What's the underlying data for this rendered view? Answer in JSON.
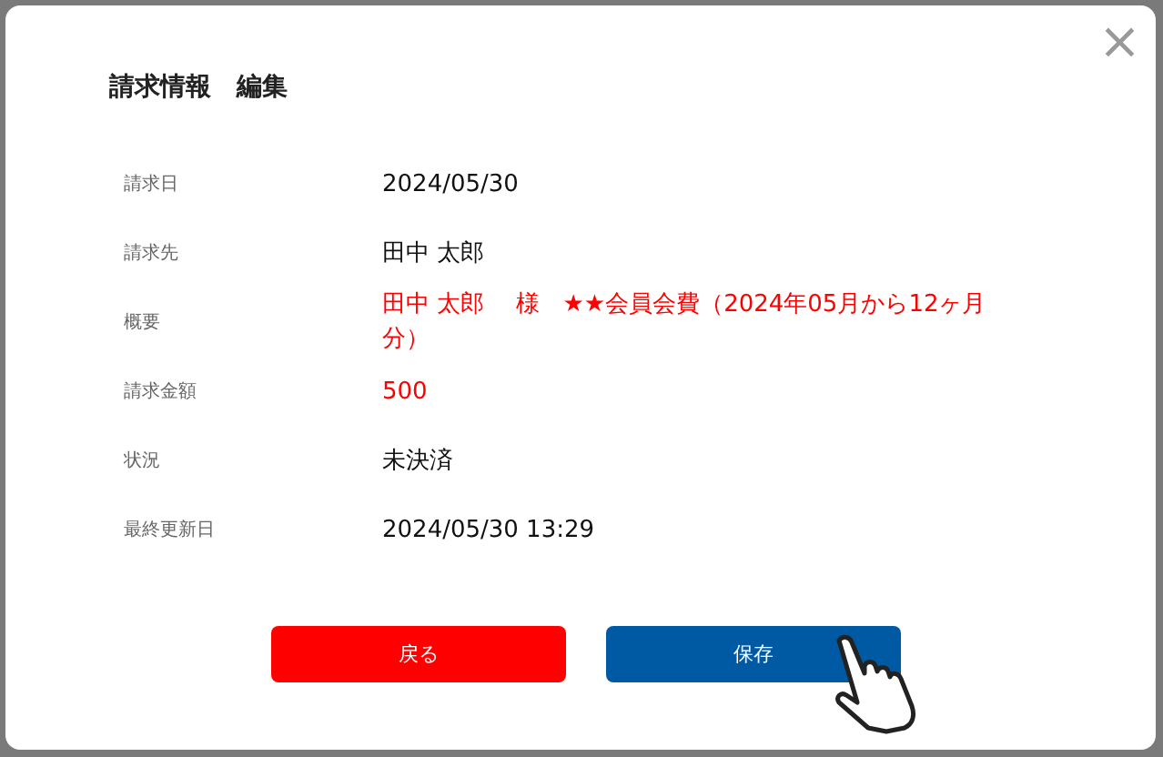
{
  "dialog": {
    "title": "請求情報　編集",
    "close": "×",
    "fields": [
      {
        "label": "請求日",
        "value": "2024/05/30",
        "highlight": false
      },
      {
        "label": "請求先",
        "value": "田中 太郎",
        "highlight": false
      },
      {
        "label": "概要",
        "value": "田中 太郎　 様　★★会員会費（2024年05月から12ヶ月分）",
        "highlight": true
      },
      {
        "label": "請求金額",
        "value": "500",
        "highlight": true
      },
      {
        "label": "状況",
        "value": "未決済",
        "highlight": false
      },
      {
        "label": "最終更新日",
        "value": "2024/05/30 13:29",
        "highlight": false
      }
    ],
    "buttons": [
      {
        "label": "戻る",
        "kind": "back"
      },
      {
        "label": "保存",
        "kind": "save"
      }
    ]
  }
}
